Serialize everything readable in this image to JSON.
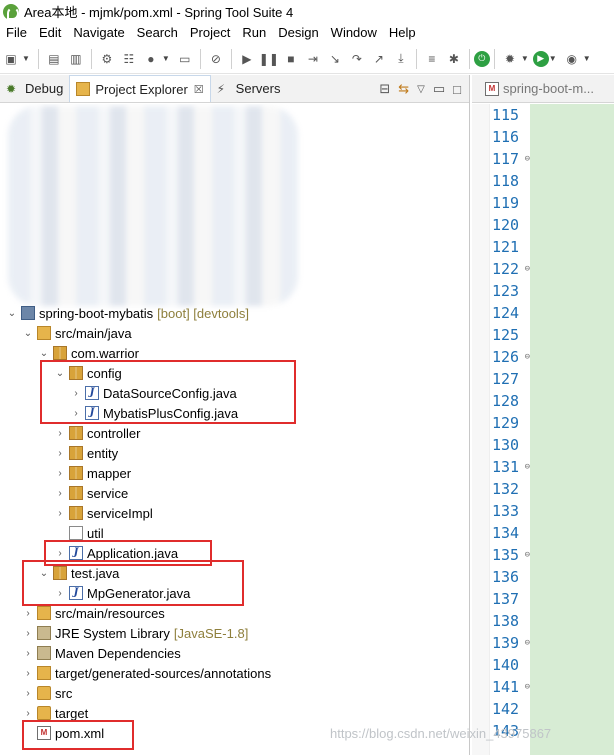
{
  "window": {
    "title": "Area本地 - mjmk/pom.xml - Spring Tool Suite 4"
  },
  "menu": [
    "File",
    "Edit",
    "Navigate",
    "Search",
    "Project",
    "Run",
    "Design",
    "Window",
    "Help"
  ],
  "view_tabs": [
    {
      "label": "Debug",
      "icon": "debug-icon"
    },
    {
      "label": "Project Explorer",
      "icon": "project-explorer-icon",
      "close": "☒"
    },
    {
      "label": "Servers",
      "icon": "servers-icon"
    }
  ],
  "editor_tab": {
    "label": "spring-boot-m..."
  },
  "tree": {
    "project": {
      "label": "spring-boot-mybatis",
      "decoration": "[boot] [devtools]"
    },
    "src_main_java": "src/main/java",
    "com_warrior": "com.warrior",
    "config": "config",
    "datasource_config": "DataSourceConfig.java",
    "mybatisplus_config": "MybatisPlusConfig.java",
    "controller": "controller",
    "entity": "entity",
    "mapper": "mapper",
    "service": "service",
    "service_impl": "serviceImpl",
    "util": "util",
    "application": "Application.java",
    "test_java": "test.java",
    "mp_generator": "MpGenerator.java",
    "src_main_resources": "src/main/resources",
    "jre": {
      "label": "JRE System Library",
      "decoration": "[JavaSE-1.8]"
    },
    "maven_deps": "Maven Dependencies",
    "target_generated": "target/generated-sources/annotations",
    "src": "src",
    "target": "target",
    "pom": "pom.xml"
  },
  "line_numbers": [
    "115",
    "116",
    "117",
    "118",
    "119",
    "120",
    "121",
    "122",
    "123",
    "124",
    "125",
    "126",
    "127",
    "128",
    "129",
    "130",
    "131",
    "132",
    "133",
    "134",
    "135",
    "136",
    "137",
    "138",
    "139",
    "140",
    "141",
    "142",
    "143"
  ],
  "folded_lines": [
    "117",
    "122",
    "126",
    "131",
    "135",
    "139",
    "141"
  ],
  "watermark": "https://blog.csdn.net/weixin_43975867",
  "colors": {
    "highlight_box": "#e02c2c",
    "editor_bg": "#d7ecd4",
    "line_number": "#1f6fb3"
  }
}
